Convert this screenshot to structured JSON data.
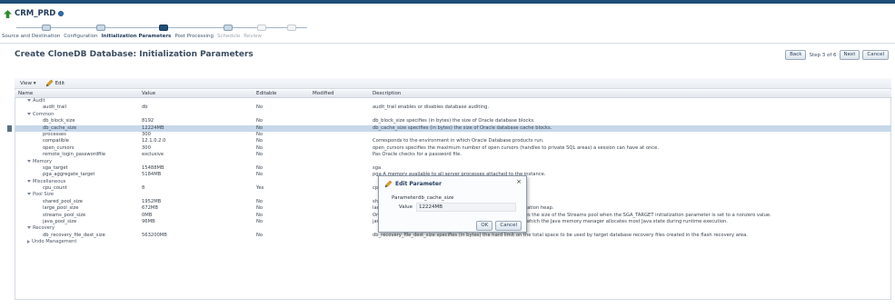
{
  "app": {
    "title": "CRM_PRD"
  },
  "train": {
    "steps": [
      {
        "label": "Source and Destination",
        "state": "done"
      },
      {
        "label": "Configuration",
        "state": "done"
      },
      {
        "label": "Initialization Parameters",
        "state": "current"
      },
      {
        "label": "Post Processing",
        "state": "done"
      },
      {
        "label": "Schedule",
        "state": "todo"
      },
      {
        "label": "Review",
        "state": "todo"
      }
    ]
  },
  "page": {
    "title": "Create CloneDB Database: Initialization Parameters",
    "back_label": "Back",
    "step_text": "Step 3 of 6",
    "next_label": "Next",
    "cancel_label": "Cancel"
  },
  "toolbar": {
    "view_label": "View ▾",
    "edit_label": "Edit"
  },
  "table": {
    "columns": [
      "Name",
      "Value",
      "Editable",
      "Modified",
      "Description"
    ],
    "rows": [
      {
        "type": "group",
        "name": "Audit",
        "open": true
      },
      {
        "type": "param",
        "name": "audit_trail",
        "value": "db",
        "editable": "No",
        "modified": "",
        "description": "audit_trail enables or disables database auditing."
      },
      {
        "type": "group",
        "name": "Common",
        "open": true
      },
      {
        "type": "param",
        "name": "db_block_size",
        "value": "8192",
        "editable": "No",
        "modified": "",
        "description": "db_block_size specifies (in bytes) the size of Oracle database blocks."
      },
      {
        "type": "param",
        "name": "db_cache_size",
        "value": "12224MB",
        "editable": "No",
        "modified": "",
        "description": "db_cache_size specifies (in bytes) the size of Oracle database cache blocks.",
        "selected": true
      },
      {
        "type": "param",
        "name": "processes",
        "value": "300",
        "editable": "No",
        "modified": "",
        "description": ""
      },
      {
        "type": "param",
        "name": "compatible",
        "value": "12.1.0.2.0",
        "editable": "No",
        "modified": "",
        "description": "Corresponds to the environment in which Oracle Database products run."
      },
      {
        "type": "param",
        "name": "open_cursors",
        "value": "300",
        "editable": "No",
        "modified": "",
        "description": "open_cursors specifies the maximum number of open cursors (handles to private SQL areas) a session can have at once."
      },
      {
        "type": "param",
        "name": "remote_login_passwordfile",
        "value": "exclusive",
        "editable": "No",
        "modified": "",
        "description": "Pas                                        Oracle checks for a password file."
      },
      {
        "type": "group",
        "name": "Memory",
        "open": true
      },
      {
        "type": "param",
        "name": "sga_target",
        "value": "15488MB",
        "editable": "No",
        "modified": "",
        "description": "sga"
      },
      {
        "type": "param",
        "name": "pga_aggregate_target",
        "value": "5184MB",
        "editable": "No",
        "modified": "",
        "description": "pga                                                                    A memory available to all server processes attached to the instance."
      },
      {
        "type": "group",
        "name": "Miscellaneous",
        "open": true
      },
      {
        "type": "param",
        "name": "cpu_count",
        "value": "8",
        "editable": "Yes",
        "modified": "",
        "description": "cpu                                                                    e."
      },
      {
        "type": "group",
        "name": "Pool Size",
        "open": true
      },
      {
        "type": "param",
        "name": "shared_pool_size",
        "value": "1952MB",
        "editable": "No",
        "modified": "",
        "description": "shared_pool_size specifies (in bytes) the size of the shared pool."
      },
      {
        "type": "param",
        "name": "large_pool_size",
        "value": "672MB",
        "editable": "No",
        "modified": "",
        "description": "large_pool_size specifies (in bytes) the size of the large pool allocation heap."
      },
      {
        "type": "param",
        "name": "streams_pool_size",
        "value": "0MB",
        "editable": "No",
        "modified": "",
        "description": "Oracle's Automatic Shared Memory Management feature manages the size of the Streams pool when the SGA_TARGET initialization parameter is set to a nonzero value."
      },
      {
        "type": "param",
        "name": "java_pool_size",
        "value": "96MB",
        "editable": "No",
        "modified": "",
        "description": "java_pool_size specifies (in bytes) the size of the Java pool, from which the Java memory manager allocates most Java state during runtime execution."
      },
      {
        "type": "group",
        "name": "Recovery",
        "open": true
      },
      {
        "type": "param",
        "name": "db_recovery_file_dest_size",
        "value": "563200MB",
        "editable": "No",
        "modified": "",
        "description": "db_recovery_file_dest_size specifies (in bytes) the hard limit on the total space to be used by target database recovery files created in the flash recovery area."
      },
      {
        "type": "group",
        "name": "Undo Management",
        "open": false
      }
    ]
  },
  "dialog": {
    "title": "Edit Parameter",
    "close_label": "×",
    "parameter_label": "Parameter",
    "parameter_value": "db_cache_size",
    "value_label": "Value",
    "value_value": "12224MB",
    "ok_label": "OK",
    "cancel_label": "Cancel"
  }
}
